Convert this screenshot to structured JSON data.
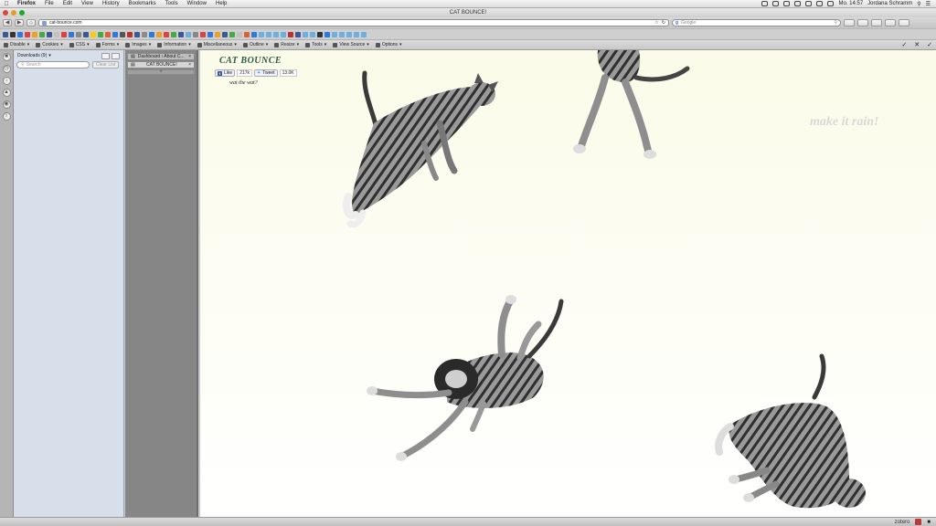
{
  "menubar": {
    "items": [
      "Firefox",
      "File",
      "Edit",
      "View",
      "History",
      "Bookmarks",
      "Tools",
      "Window",
      "Help"
    ],
    "clock": "Mo. 14:57",
    "user": "Jordana Schramm"
  },
  "window": {
    "title": "CAT BOUNCE!"
  },
  "navbar": {
    "url": "cat-bounce.com",
    "search_engine": "Google",
    "search_placeholder": "Google"
  },
  "devbar": {
    "items": [
      "Disable",
      "Cookies",
      "CSS",
      "Forms",
      "Images",
      "Information",
      "Miscellaneous",
      "Outline",
      "Resize",
      "Tools",
      "View Source",
      "Options"
    ]
  },
  "downloads": {
    "title": "Downloads (9)",
    "search_placeholder": "Search",
    "clear_label": "Clear List"
  },
  "tabs": {
    "items": [
      {
        "label": "Dashboard ‹ About C..."
      },
      {
        "label": "CAT BOUNCE!"
      }
    ],
    "new_tab": "+"
  },
  "page": {
    "site_title": "CAT BOUNCE",
    "like_label": "Like",
    "like_count": "217k",
    "tweet_label": "Tweet",
    "tweet_count": "13.0K",
    "tagline": "wat the wat?",
    "make_it_rain": "make it rain!"
  },
  "statusbar": {
    "addon": "zotero"
  },
  "colors": {
    "content_bg": "#fbfbe9",
    "site_title": "#2a5a40",
    "sidebar_bg": "#d7dfea",
    "tabs_bg": "#868686"
  }
}
